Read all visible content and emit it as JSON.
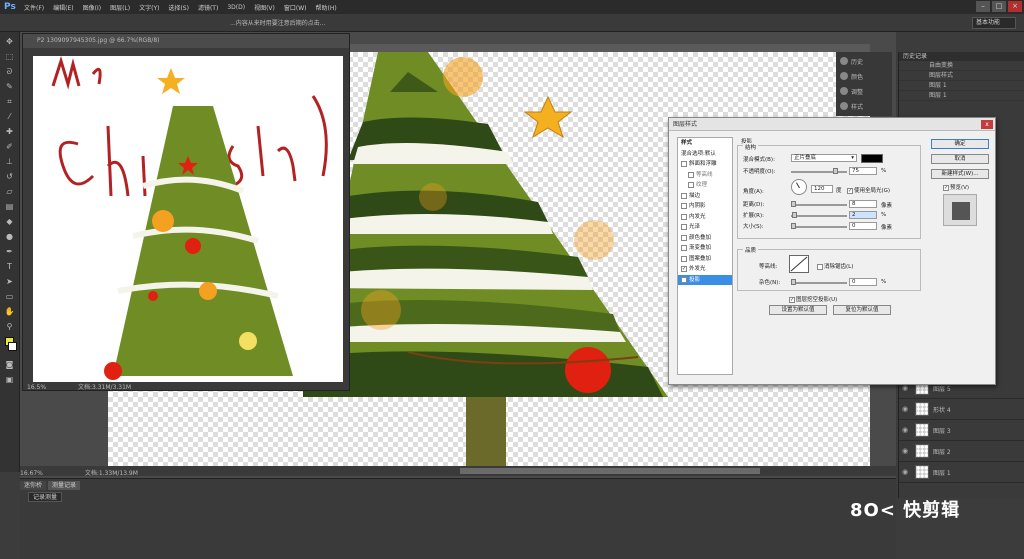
{
  "app": {
    "logo": "Ps"
  },
  "menu": [
    "文件(F)",
    "编辑(E)",
    "图像(I)",
    "图层(L)",
    "文字(Y)",
    "选择(S)",
    "滤镜(T)",
    "3D(D)",
    "视图(V)",
    "窗口(W)",
    "帮助(H)"
  ],
  "options_bar": {
    "doc_title": "...内容从来时用要注意后期的点击...",
    "workspace": "基本功能"
  },
  "float_doc": {
    "title": "P2 1309097945305.jpg @ 66.7%(RGB/8)",
    "status": "文档:3.31M/3.31M",
    "zoom": "16.5%"
  },
  "main_status": {
    "zoom": "16.67%",
    "doc": "文档:1.33M/13.9M"
  },
  "bottom_panel": {
    "tabs": [
      "迷你桥",
      "测量记录"
    ],
    "record_button": "记录测量"
  },
  "icon_strip": [
    "历史",
    "颜色",
    "调整",
    "样式"
  ],
  "history": {
    "header": "历史记录",
    "rows": [
      "自由变换",
      "图层样式",
      "图层 1",
      "图层 1"
    ]
  },
  "layers": [
    {
      "name": "图层 5"
    },
    {
      "name": "形状 4"
    },
    {
      "name": "图层 3"
    },
    {
      "name": "图层 2"
    },
    {
      "name": "图层 1"
    }
  ],
  "dialog": {
    "title": "图层样式",
    "close": "x",
    "styles_header": "样式",
    "blend_options": "混合选项:默认",
    "style_items": [
      {
        "label": "斜面和浮雕",
        "checked": false,
        "sub": false,
        "sel": false
      },
      {
        "label": "等高线",
        "checked": false,
        "sub": true,
        "sel": false
      },
      {
        "label": "纹理",
        "checked": false,
        "sub": true,
        "sel": false
      },
      {
        "label": "描边",
        "checked": false,
        "sub": false,
        "sel": false
      },
      {
        "label": "内阴影",
        "checked": false,
        "sub": false,
        "sel": false
      },
      {
        "label": "内发光",
        "checked": false,
        "sub": false,
        "sel": false
      },
      {
        "label": "光泽",
        "checked": false,
        "sub": false,
        "sel": false
      },
      {
        "label": "颜色叠加",
        "checked": false,
        "sub": false,
        "sel": false
      },
      {
        "label": "渐变叠加",
        "checked": false,
        "sub": false,
        "sel": false
      },
      {
        "label": "图案叠加",
        "checked": false,
        "sub": false,
        "sel": false
      },
      {
        "label": "外发光",
        "checked": true,
        "sub": false,
        "sel": false
      },
      {
        "label": "投影",
        "checked": true,
        "sub": false,
        "sel": true
      }
    ],
    "section_title": "投影",
    "structure_title": "结构",
    "blend_mode_label": "混合模式(B):",
    "blend_mode_value": "正片叠底",
    "opacity_label": "不透明度(O):",
    "opacity_value": "75",
    "opacity_pct": 0.75,
    "angle_label": "角度(A):",
    "angle_value": "120",
    "angle_unit": "度",
    "global_light": "使用全局光(G)",
    "distance_label": "距离(D):",
    "distance_value": "8",
    "distance_unit": "像素",
    "spread_label": "扩展(R):",
    "spread_value": "2",
    "spread_unit": "%",
    "size_label": "大小(S):",
    "size_value": "0",
    "size_unit": "像素",
    "quality_title": "品质",
    "contour_label": "等高线:",
    "antialias": "消除锯齿(L)",
    "noise_label": "杂色(N):",
    "noise_value": "0",
    "pct": "%",
    "knockout": "图层挖空投影(U)",
    "make_default": "设置为默认值",
    "reset_default": "复位为默认值",
    "ok": "确定",
    "cancel": "取消",
    "new_style": "新建样式(W)...",
    "preview": "预览(V)"
  },
  "watermark": "8O< 快剪辑",
  "colors": {
    "shadow": "#000000",
    "accent": "#3a8ee6"
  }
}
